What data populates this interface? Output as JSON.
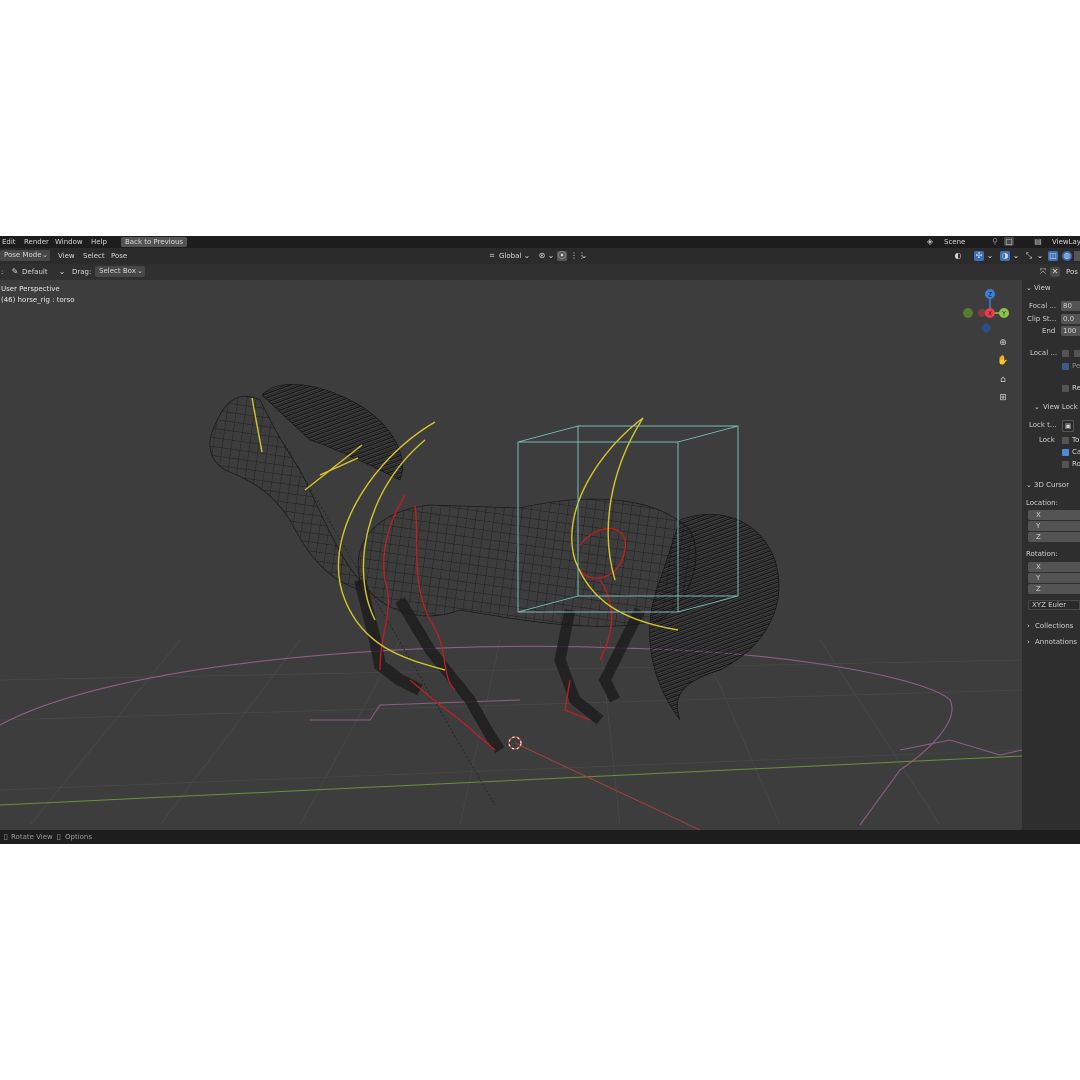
{
  "menubar": {
    "items": [
      "Edit",
      "Render",
      "Window",
      "Help"
    ],
    "back_button": "Back to Previous",
    "scene_label": "Scene",
    "viewlayer_label": "ViewLay"
  },
  "header": {
    "mode": "Pose Mode",
    "menus": [
      "View",
      "Select",
      "Pose"
    ],
    "transform_orientation": "Global"
  },
  "toolbar": {
    "prefix": ":",
    "preset": "Default",
    "drag_label": "Drag:",
    "drag_mode": "Select Box",
    "npanel_tab": "Pos"
  },
  "viewport": {
    "perspective": "User Perspective",
    "object_info": "(46) horse_rig : torso"
  },
  "gizmo": {
    "z": "Z",
    "x": "X",
    "y": "Y"
  },
  "npanel": {
    "view_header": "View",
    "focal_label": "Focal ...",
    "focal_value": "80",
    "clip_start_label": "Clip St...",
    "clip_start_value": "0.0",
    "end_label": "End",
    "end_value": "100",
    "local_label": "Local ...",
    "pe_label": "Pe",
    "re_label": "Re",
    "view_lock_header": "View Lock",
    "lock_to_label": "Lock t...",
    "lock_label": "Lock",
    "to_label": "To",
    "ca_label": "Ca",
    "ro_label": "Ro",
    "cursor_header": "3D Cursor",
    "location_label": "Location:",
    "loc_x": "X",
    "loc_y": "Y",
    "loc_z": "Z",
    "rotation_label": "Rotation:",
    "rot_x": "X",
    "rot_y": "Y",
    "rot_z": "Z",
    "rotation_mode": "XYZ Euler",
    "collections_header": "Collections",
    "annotations_header": "Annotations"
  },
  "statusbar": {
    "rotate_view": "Rotate View",
    "options": "Options"
  },
  "colors": {
    "bone_yellow": "#d6c52a",
    "bone_red": "#c41e1e",
    "bbox_teal": "#7fc8c2",
    "axis_x": "#e8404f",
    "axis_y": "#8cc34a",
    "axis_z": "#3b7fd9",
    "grid_pink": "#8d5f86"
  }
}
